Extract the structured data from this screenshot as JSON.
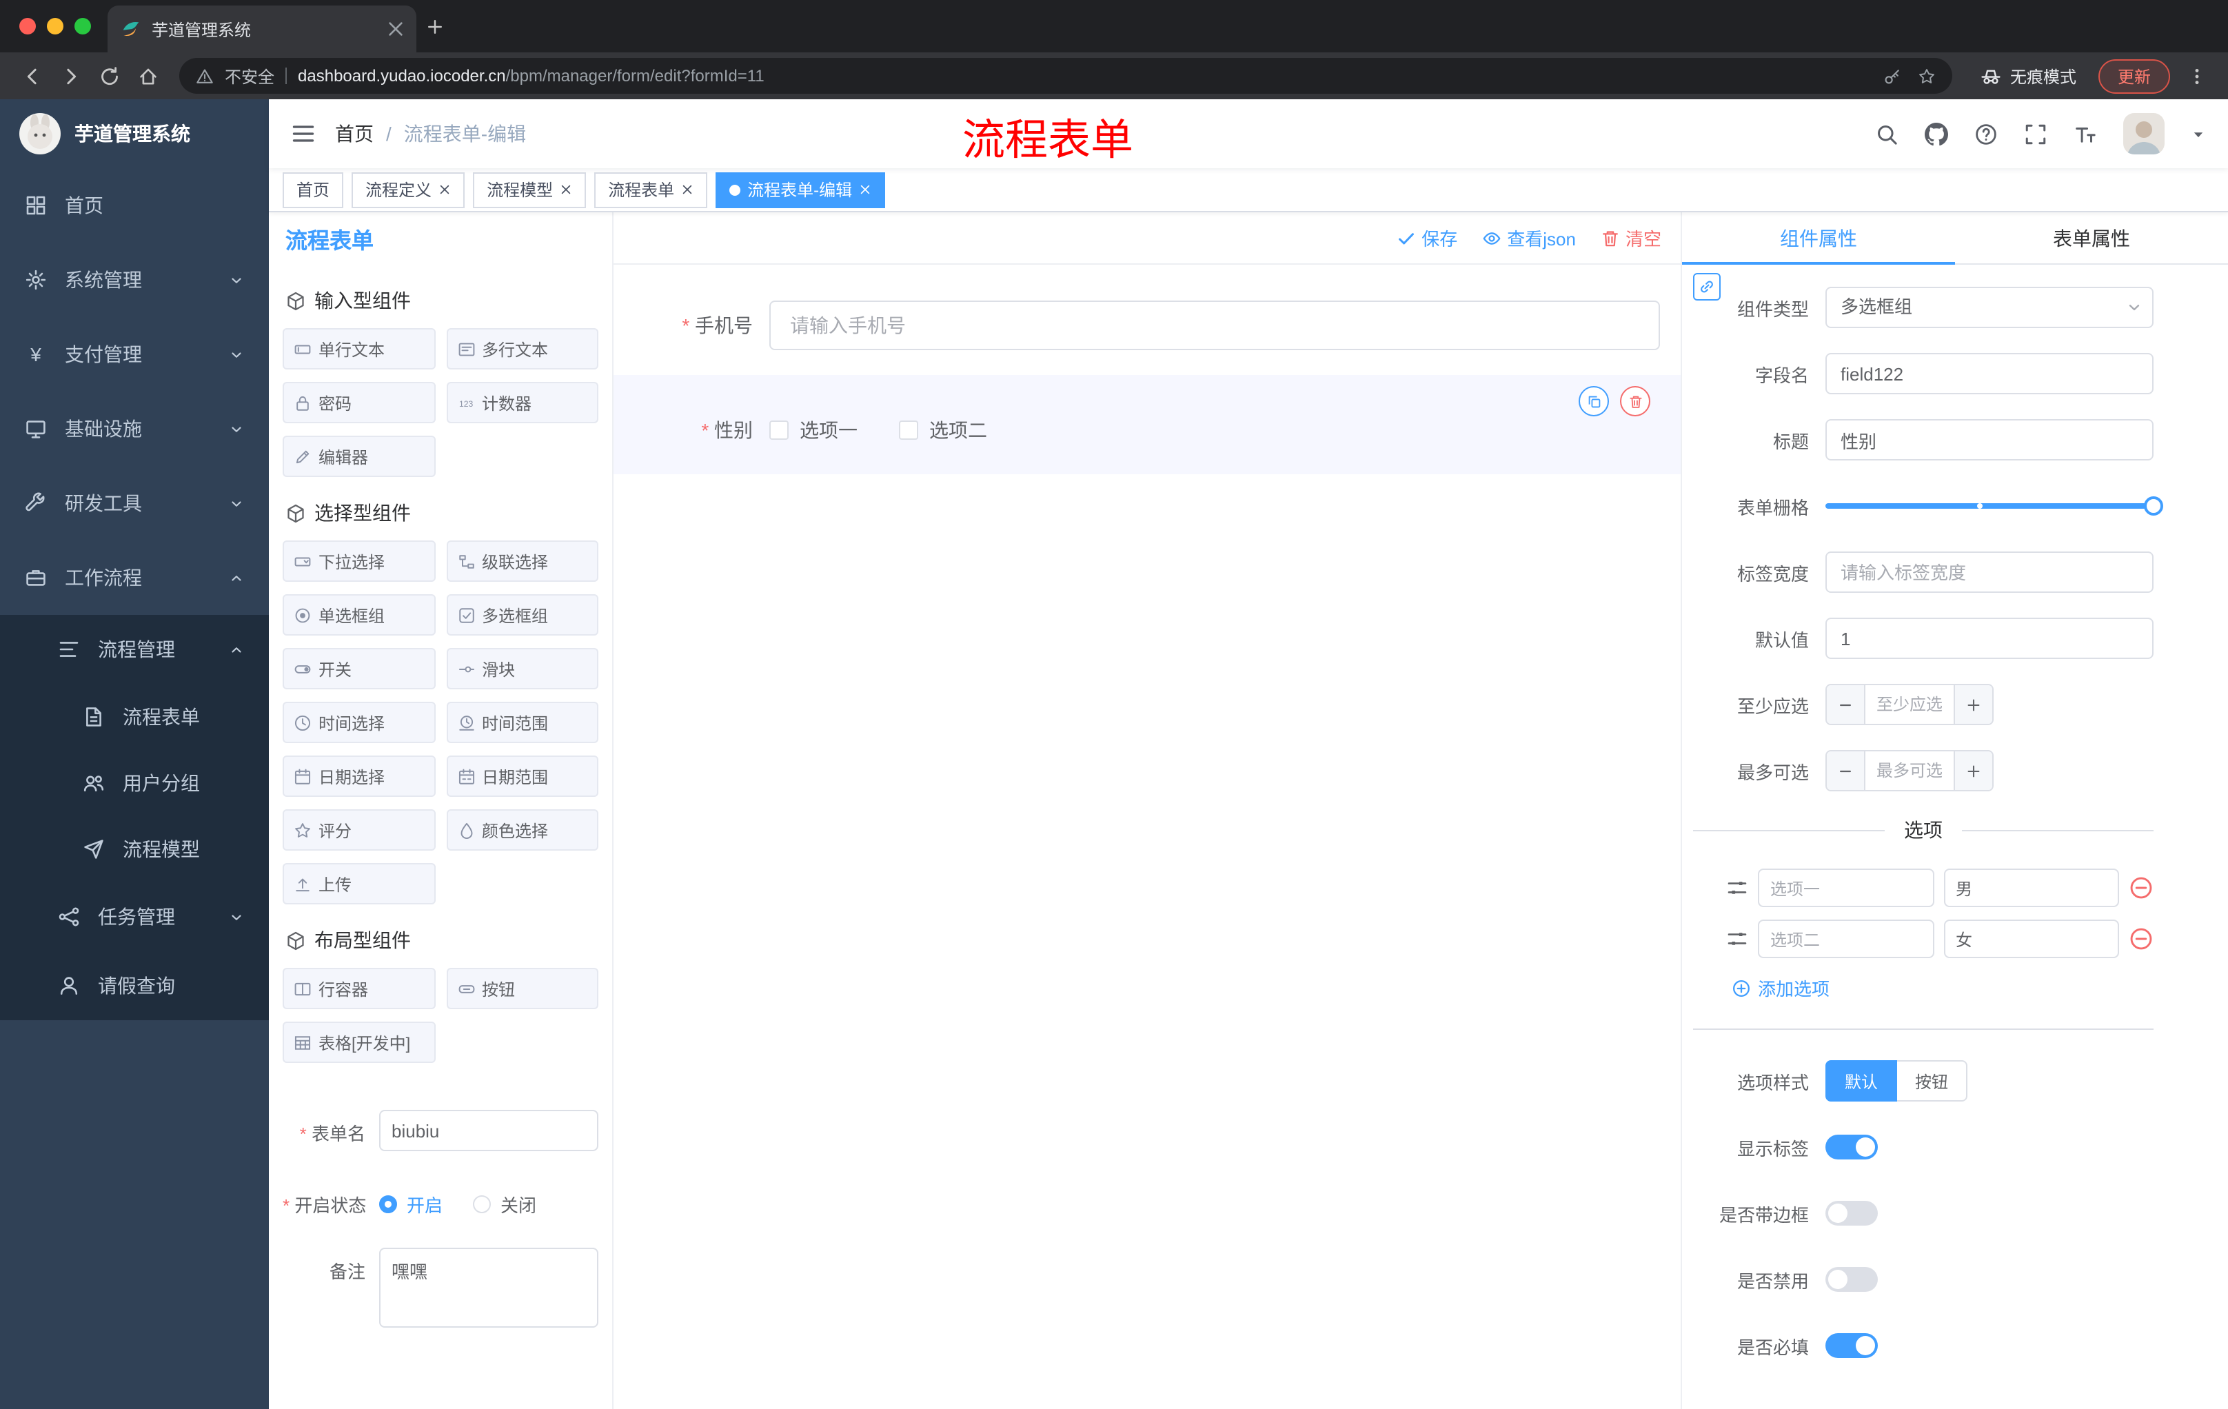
{
  "browser": {
    "tab_title": "芋道管理系统",
    "security": "不安全",
    "url_host": "dashboard.yudao.iocoder.cn",
    "url_path": "/bpm/manager/form/edit?formId=11",
    "incognito": "无痕模式",
    "update": "更新"
  },
  "annotation": {
    "text": "流程表单"
  },
  "sidebar": {
    "logo_title": "芋道管理系统",
    "items": {
      "home": "首页",
      "system": "系统管理",
      "payment": "支付管理",
      "infra": "基础设施",
      "devtools": "研发工具",
      "workflow": "工作流程",
      "process_mgmt": "流程管理",
      "process_form": "流程表单",
      "user_group": "用户分组",
      "process_model": "流程模型",
      "task_mgmt": "任务管理",
      "leave_query": "请假查询"
    }
  },
  "header": {
    "breadcrumb_root": "首页",
    "breadcrumb_sep": "/",
    "breadcrumb_current": "流程表单-编辑"
  },
  "tags": [
    {
      "label": "首页"
    },
    {
      "label": "流程定义"
    },
    {
      "label": "流程模型"
    },
    {
      "label": "流程表单"
    },
    {
      "label": "流程表单-编辑"
    }
  ],
  "palette": {
    "title": "流程表单",
    "groups": [
      {
        "title": "输入型组件",
        "items": [
          {
            "label": "单行文本",
            "icon": "#i-inputbox"
          },
          {
            "label": "多行文本",
            "icon": "#i-textarea"
          },
          {
            "label": "密码",
            "icon": "#i-lock"
          },
          {
            "label": "计数器",
            "icon": "#i-counter"
          },
          {
            "label": "编辑器",
            "icon": "#i-editor"
          }
        ]
      },
      {
        "title": "选择型组件",
        "items": [
          {
            "label": "下拉选择",
            "icon": "#i-select"
          },
          {
            "label": "级联选择",
            "icon": "#i-cascader"
          },
          {
            "label": "单选框组",
            "icon": "#i-radio"
          },
          {
            "label": "多选框组",
            "icon": "#i-checksq"
          },
          {
            "label": "开关",
            "icon": "#i-switch"
          },
          {
            "label": "滑块",
            "icon": "#i-slider"
          },
          {
            "label": "时间选择",
            "icon": "#i-clock"
          },
          {
            "label": "时间范围",
            "icon": "#i-clockr"
          },
          {
            "label": "日期选择",
            "icon": "#i-cal"
          },
          {
            "label": "日期范围",
            "icon": "#i-calr"
          },
          {
            "label": "评分",
            "icon": "#i-star"
          },
          {
            "label": "颜色选择",
            "icon": "#i-droplet"
          },
          {
            "label": "上传",
            "icon": "#i-upload"
          }
        ]
      },
      {
        "title": "布局型组件",
        "items": [
          {
            "label": "行容器",
            "icon": "#i-row"
          },
          {
            "label": "按钮",
            "icon": "#i-btn"
          },
          {
            "label": "表格[开发中]",
            "icon": "#i-table"
          }
        ]
      }
    ],
    "form": {
      "name_label": "表单名",
      "name_value": "biubiu",
      "status_label": "开启状态",
      "status_on": "开启",
      "status_off": "关闭",
      "remark_label": "备注",
      "remark_value": "嘿嘿"
    }
  },
  "canvas": {
    "actions": {
      "save": "保存",
      "view_json": "查看json",
      "clear": "清空"
    },
    "phone": {
      "label": "手机号",
      "placeholder": "请输入手机号"
    },
    "gender": {
      "label": "性别",
      "options": [
        "选项一",
        "选项二"
      ]
    }
  },
  "inspector": {
    "tabs": {
      "component": "组件属性",
      "form": "表单属性"
    },
    "component_type": {
      "label": "组件类型",
      "value": "多选框组"
    },
    "field_name": {
      "label": "字段名",
      "value": "field122"
    },
    "title_field": {
      "label": "标题",
      "value": "性别"
    },
    "grid": {
      "label": "表单栅格"
    },
    "label_width": {
      "label": "标签宽度",
      "placeholder": "请输入标签宽度"
    },
    "default_value": {
      "label": "默认值",
      "value": "1"
    },
    "min_select": {
      "label": "至少应选",
      "placeholder": "至少应选"
    },
    "max_select": {
      "label": "最多可选",
      "placeholder": "最多可选"
    },
    "options_title": "选项",
    "options": [
      {
        "label": "选项一",
        "value": "男"
      },
      {
        "label": "选项二",
        "value": "女"
      }
    ],
    "add_option": "添加选项",
    "option_style": {
      "label": "选项样式",
      "options": [
        "默认",
        "按钮"
      ],
      "selected": "默认"
    },
    "switches": [
      {
        "label": "显示标签",
        "on": true
      },
      {
        "label": "是否带边框",
        "on": false
      },
      {
        "label": "是否禁用",
        "on": false
      },
      {
        "label": "是否必填",
        "on": true
      }
    ]
  },
  "colors": {
    "accent": "#409eff",
    "danger": "#f56c6c",
    "sidebar_bg": "#304156",
    "submenu_bg": "#1f2d3d",
    "selected_item_bg": "#f6f7ff"
  }
}
